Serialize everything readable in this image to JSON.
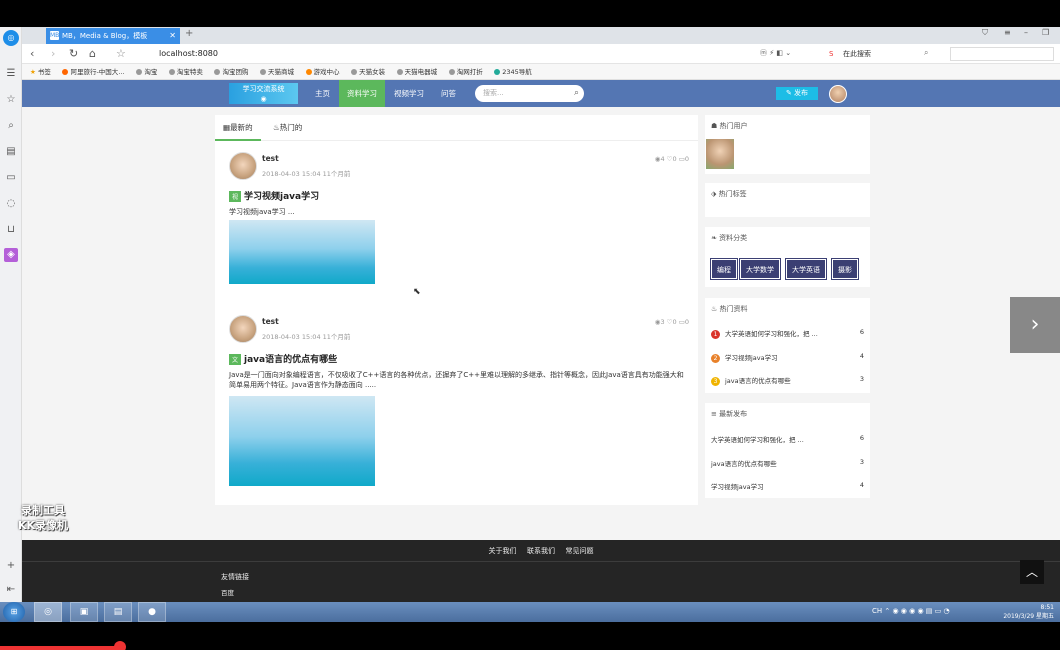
{
  "browser": {
    "tab_title": "MB，Media & Blog，模板",
    "tab_icon": "MB",
    "url": "localhost:8080",
    "search_engine_label": "在此搜索",
    "bookmarks": [
      "书签",
      "阿里旅行-中国大…",
      "淘宝",
      "淘宝特卖",
      "淘宝团购",
      "天猫商城",
      "游戏中心",
      "天猫女装",
      "天猫电器城",
      "淘网打折",
      "2345导航"
    ]
  },
  "site": {
    "logo_text": "学习交流系统",
    "nav": [
      "主页",
      "资料学习",
      "视频学习",
      "问答"
    ],
    "active_nav": "资料学习",
    "search_placeholder": "搜索...",
    "publish_label": "发布",
    "feed_tabs": [
      "最新的",
      "热门的"
    ]
  },
  "posts": [
    {
      "user": "test",
      "time": "2018-04-03 15:04 11个月前",
      "views": "4",
      "likes": "0",
      "comments": "0",
      "badge": "视",
      "title": "学习视频java学习",
      "summary": "学习视频java学习 ..."
    },
    {
      "user": "test",
      "time": "2018-04-03 15:04 11个月前",
      "views": "3",
      "likes": "0",
      "comments": "0",
      "badge": "文",
      "title": "java语言的优点有哪些",
      "summary": "Java是一门面向对象编程语言，不仅吸收了C++语言的各种优点，还摒弃了C++里难以理解的多继承、指针等概念，因此Java语言具有功能强大和简单易用两个特征。Java语言作为静态面向 ....."
    }
  ],
  "sidebar": {
    "hot_users_title": "热门用户",
    "hot_tags_title": "热门标签",
    "categories_title": "资料分类",
    "categories": [
      "编程",
      "大学数学",
      "大学英语",
      "摄影"
    ],
    "hot_docs_title": "热门资料",
    "hot_docs": [
      {
        "rank": "1",
        "title": "大学英语如何学习和强化，把 ...",
        "count": "6",
        "color": "#d9342b"
      },
      {
        "rank": "2",
        "title": "学习视频java学习",
        "count": "4",
        "color": "#e8812a"
      },
      {
        "rank": "3",
        "title": "java语言的优点有哪些",
        "count": "3",
        "color": "#f0b400"
      }
    ],
    "latest_title": "最新发布",
    "latest": [
      {
        "title": "大学英语如何学习和强化，把 ...",
        "count": "6"
      },
      {
        "title": "java语言的优点有哪些",
        "count": "3"
      },
      {
        "title": "学习视频java学习",
        "count": "4"
      }
    ]
  },
  "footer": {
    "links": [
      "关于我们",
      "联系我们",
      "常见问题"
    ],
    "friend_title": "友情链接",
    "friend_link": "百度"
  },
  "watermark": {
    "line1": "录制工具",
    "line2": "KK录像机"
  },
  "taskbar": {
    "time": "8:51",
    "date": "2019/3/29 星期五",
    "ime": "CH"
  }
}
